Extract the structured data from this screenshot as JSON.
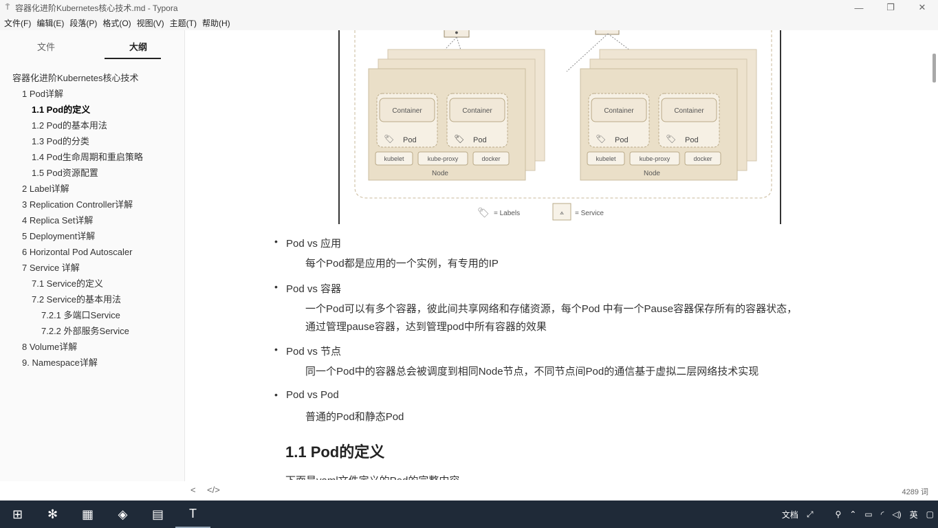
{
  "window": {
    "title": "容器化进阶Kubernetes核心技术.md - Typora",
    "icon": "typora-icon"
  },
  "menu": [
    "文件(F)",
    "编辑(E)",
    "段落(P)",
    "格式(O)",
    "视图(V)",
    "主题(T)",
    "帮助(H)"
  ],
  "sidebar": {
    "tabs": [
      "文件",
      "大纲"
    ],
    "active_tab": "大纲",
    "outline": [
      {
        "label": "容器化进阶Kubernetes核心技术",
        "level": 0
      },
      {
        "label": "1 Pod详解",
        "level": 1
      },
      {
        "label": "1.1 Pod的定义",
        "level": 2,
        "active": true
      },
      {
        "label": "1.2 Pod的基本用法",
        "level": 2
      },
      {
        "label": "1.3 Pod的分类",
        "level": 2
      },
      {
        "label": "1.4 Pod生命周期和重启策略",
        "level": 2
      },
      {
        "label": "1.5 Pod资源配置",
        "level": 2
      },
      {
        "label": "2 Label详解",
        "level": 1
      },
      {
        "label": "3 Replication Controller详解",
        "level": 1
      },
      {
        "label": "4 Replica Set详解",
        "level": 1
      },
      {
        "label": "5 Deployment详解",
        "level": 1
      },
      {
        "label": "6 Horizontal Pod Autoscaler",
        "level": 1
      },
      {
        "label": "7 Service 详解",
        "level": 1
      },
      {
        "label": "7.1 Service的定义",
        "level": 2
      },
      {
        "label": "7.2 Service的基本用法",
        "level": 2
      },
      {
        "label": "7.2.1 多端口Service",
        "level": 3
      },
      {
        "label": "7.2.2 外部服务Service",
        "level": 3
      },
      {
        "label": "8 Volume详解",
        "level": 1
      },
      {
        "label": "9. Namespace详解",
        "level": 1
      }
    ]
  },
  "diagram": {
    "container_label": "Container",
    "pod_label": "Pod",
    "kubelet": "kubelet",
    "kube_proxy": "kube-proxy",
    "docker": "docker",
    "node_label": "Node",
    "legend_labels": "= Labels",
    "legend_service": "= Service"
  },
  "content": {
    "items": [
      {
        "bullet": "Pod vs 应用",
        "para": [
          "每个Pod都是应用的一个实例，有专用的IP"
        ]
      },
      {
        "bullet": "Pod vs 容器",
        "para": [
          "一个Pod可以有多个容器，彼此间共享网络和存储资源，每个Pod 中有一个Pause容器保存所有的容器状态，",
          "通过管理pause容器，达到管理pod中所有容器的效果"
        ]
      },
      {
        "bullet": "Pod vs 节点",
        "para": [
          "同一个Pod中的容器总会被调度到相同Node节点，不同节点间Pod的通信基于虚拟二层网络技术实现"
        ]
      },
      {
        "bullet": "Pod vs Pod",
        "para": [
          "普通的Pod和静态Pod"
        ]
      }
    ],
    "heading": "1.1 Pod的定义",
    "next_line": "下面是yaml文件定义的Pod的完整内容"
  },
  "status": {
    "word_count": "4289 词"
  },
  "taskbar": {
    "tray_doc": "文档",
    "ime": "英"
  }
}
